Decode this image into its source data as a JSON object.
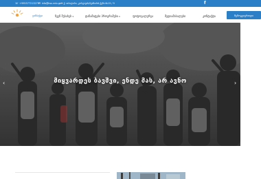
{
  "topbar": {
    "phone": "+995577213279",
    "email": "info@ksu.edu.ge",
    "address": "ქ. თბილისი, კოსტავას/ბუაჩიძის ქუჩა №15 / 9",
    "facebook_icon": "f"
  },
  "nav": {
    "logo_text": "ეიმპაქტი",
    "items": [
      {
        "label": "ჩვენ შესახებ",
        "has_caret": true
      },
      {
        "label": "დანამატები პროგრამები",
        "has_caret": true
      },
      {
        "label": "ფოტოგალერეა",
        "has_caret": false
      },
      {
        "label": "მედიამასალები",
        "has_caret": false
      },
      {
        "label": "კონტაქტი",
        "has_caret": false
      }
    ],
    "cta_label": "შემოგვიერთდი"
  },
  "hero": {
    "caption": "მიყვარდეს ბავშვი, ენდე მას, არ ავნო",
    "prev_icon": "chevron-left",
    "next_icon": "chevron-right"
  },
  "colors": {
    "accent": "#2a7fc6",
    "logo_orange": "#f4a23b"
  }
}
